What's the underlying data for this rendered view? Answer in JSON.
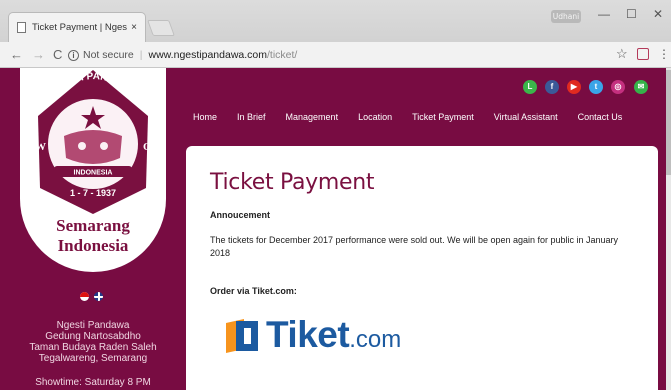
{
  "browser": {
    "tab_title": "Ticket Payment | Ngesti P",
    "tab_close": "×",
    "profile_badge": "Udhani",
    "minimize": "—",
    "maximize": "☐",
    "close": "✕",
    "back": "←",
    "forward": "→",
    "reload": "C",
    "info": "i",
    "not_secure": "Not secure",
    "separator": "|",
    "url_host": "www.ngestipandawa.com",
    "url_path": "/ticket/",
    "bookmark": "☆",
    "menu": "⋮"
  },
  "sidebar": {
    "logo_arc_text": "NGESTI PANDOWO",
    "logo_ribbon": "INDONESIA",
    "logo_date": "1 - 7 - 1937",
    "logo_left_letter": "W",
    "logo_right_letter": "O",
    "logo_line1": "Semarang",
    "logo_line2": "Indonesia",
    "address": [
      "Ngesti Pandawa",
      "Gedung Nartosabdho",
      "Taman Budaya Raden Saleh",
      "Tegalwareng, Semarang"
    ],
    "showtime": "Showtime: Saturday 8 PM"
  },
  "social": [
    {
      "name": "line",
      "color": "#3bb54a",
      "glyph": "L"
    },
    {
      "name": "facebook",
      "color": "#3b5998",
      "glyph": "f"
    },
    {
      "name": "youtube",
      "color": "#e02a20",
      "glyph": "▶"
    },
    {
      "name": "twitter",
      "color": "#3aa4e8",
      "glyph": "t"
    },
    {
      "name": "instagram",
      "color": "#c4307f",
      "glyph": "◎"
    },
    {
      "name": "email",
      "color": "#36b24a",
      "glyph": "✉"
    }
  ],
  "nav": [
    "Home",
    "In Brief",
    "Management",
    "Location",
    "Ticket Payment",
    "Virtual Assistant",
    "Contact Us"
  ],
  "content": {
    "heading": "Ticket Payment",
    "announcement_title": "Annoucement",
    "announcement_text": "The tickets for December 2017 performance were sold out. We will be open again for public in January 2018",
    "order_label": "Order via Tiket.com:",
    "tiket_brand": "Tiket",
    "tiket_suffix": ".com"
  },
  "colors": {
    "brand_maroon": "#780c42",
    "tiket_blue": "#1c5aa0",
    "tiket_orange": "#f7941d"
  }
}
